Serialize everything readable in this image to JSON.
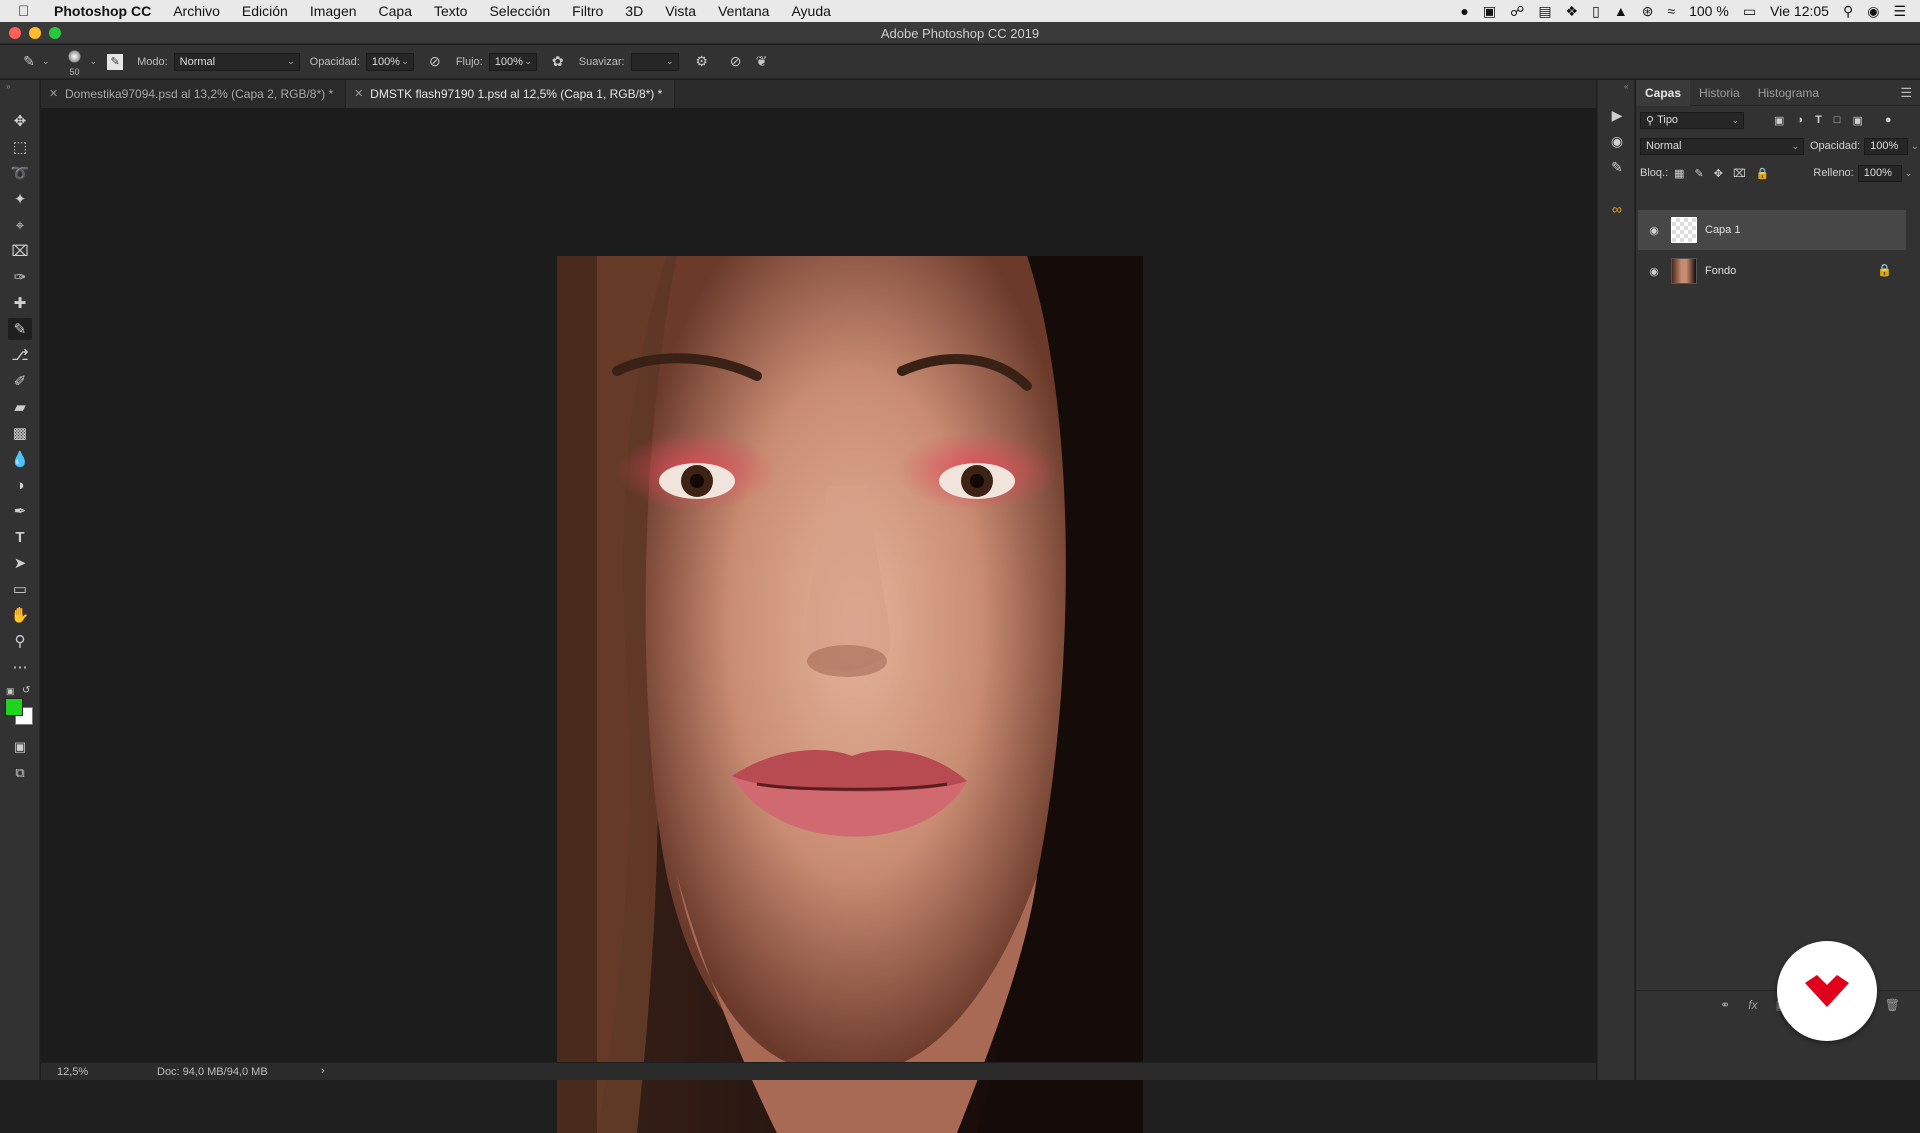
{
  "menubar": {
    "app_name": "Photoshop CC",
    "items": [
      "Archivo",
      "Edición",
      "Imagen",
      "Capa",
      "Texto",
      "Selección",
      "Filtro",
      "3D",
      "Vista",
      "Ventana",
      "Ayuda"
    ],
    "battery": "100 %",
    "clock": "Vie 12:05"
  },
  "window": {
    "title": "Adobe Photoshop CC 2019"
  },
  "options": {
    "brush_size": "50",
    "mode_label": "Modo:",
    "mode_value": "Normal",
    "opacity_label": "Opacidad:",
    "opacity_value": "100%",
    "flow_label": "Flujo:",
    "flow_value": "100%",
    "smoothing_label": "Suavizar:",
    "smoothing_value": ""
  },
  "tabs": [
    {
      "label": "Domestika97094.psd al 13,2% (Capa 2, RGB/8*) *"
    },
    {
      "label": "DMSTK flash97190 1.psd al 12,5% (Capa 1, RGB/8*) *"
    }
  ],
  "status": {
    "zoom": "12,5%",
    "doc": "Doc: 94,0 MB/94,0 MB"
  },
  "panel": {
    "tabs": [
      "Capas",
      "Historia",
      "Histograma"
    ],
    "filter_kind": "Tipo",
    "blend_mode": "Normal",
    "opacity_label": "Opacidad:",
    "opacity_value": "100%",
    "lock_label": "Bloq.:",
    "fill_label": "Relleno:",
    "fill_value": "100%",
    "layers": [
      {
        "name": "Capa 1",
        "selected": true,
        "locked": false
      },
      {
        "name": "Fondo",
        "selected": false,
        "locked": true
      }
    ]
  },
  "colors": {
    "foreground": "#1fd41f",
    "background": "#ffffff",
    "badge_red": "#e0001b"
  }
}
